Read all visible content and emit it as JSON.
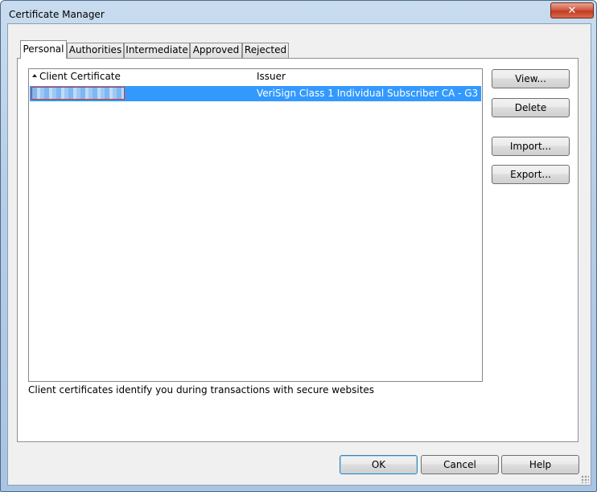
{
  "window": {
    "title": "Certificate Manager",
    "close_glyph": "✕"
  },
  "tabs": [
    {
      "label": "Personal",
      "active": true
    },
    {
      "label": "Authorities",
      "active": false
    },
    {
      "label": "Intermediate",
      "active": false
    },
    {
      "label": "Approved",
      "active": false
    },
    {
      "label": "Rejected",
      "active": false
    }
  ],
  "list": {
    "columns": {
      "client_certificate": "Client Certificate",
      "issuer": "Issuer"
    },
    "sort_icon": "sort-ascending-icon",
    "rows": [
      {
        "client_certificate": "",
        "issuer": "VeriSign Class 1 Individual Subscriber CA - G3",
        "selected": true
      }
    ]
  },
  "side_buttons": {
    "view": "View...",
    "delete": "Delete",
    "import": "Import...",
    "export": "Export..."
  },
  "info_text": "Client certificates identify you during transactions with secure websites",
  "footer_buttons": {
    "ok": "OK",
    "cancel": "Cancel",
    "help": "Help"
  },
  "colors": {
    "selection": "#3399ff",
    "redaction_border": "#e0302a"
  }
}
